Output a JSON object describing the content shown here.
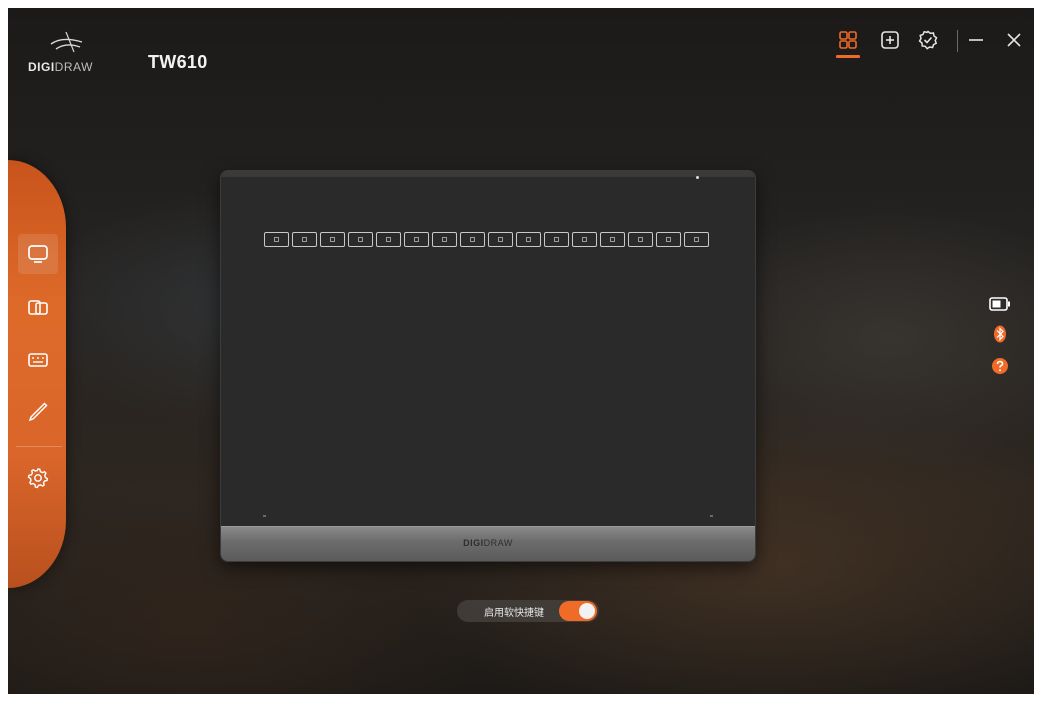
{
  "brand": {
    "logo_bold": "DIGI",
    "logo_light": "DRAW",
    "model_name": "TW610"
  },
  "colors": {
    "accent": "#f06a28",
    "sidebar": "#de6a2a",
    "tablet_surface": "#2a2a2a",
    "background": "#242220"
  },
  "topbar": {
    "buttons": [
      {
        "name": "device-view-icon",
        "active": true
      },
      {
        "name": "add-icon",
        "active": false
      },
      {
        "name": "settings-badge-icon",
        "active": false
      },
      {
        "name": "minimize-icon",
        "active": false
      },
      {
        "name": "close-icon",
        "active": false
      }
    ]
  },
  "sidebar": {
    "items": [
      {
        "name": "display-icon",
        "active": true
      },
      {
        "name": "dual-screen-icon",
        "active": false
      },
      {
        "name": "keyboard-icon",
        "active": false
      },
      {
        "name": "pen-icon",
        "active": false
      },
      {
        "name": "gear-icon",
        "active": false
      }
    ]
  },
  "tablet": {
    "brand_bold": "DIGI",
    "brand_light": "DRAW",
    "express_key_count": 16
  },
  "status": {
    "icons": [
      "battery-icon",
      "bluetooth-icon",
      "help-icon"
    ]
  },
  "soft_shortcut": {
    "label": "启用软快捷键",
    "enabled": true
  }
}
